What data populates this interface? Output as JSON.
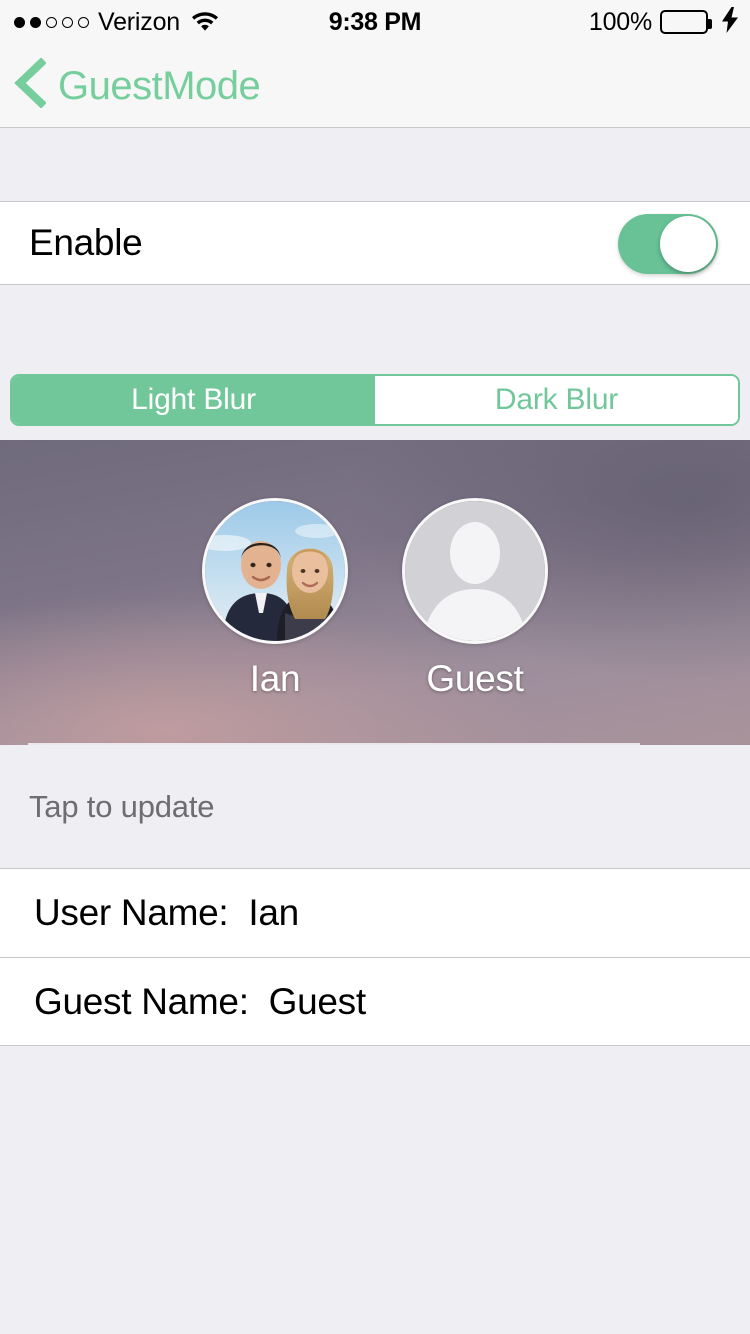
{
  "status_bar": {
    "signal_dots_filled": 2,
    "signal_dots_total": 5,
    "carrier": "Verizon",
    "wifi_icon": "wifi-icon",
    "time": "9:38 PM",
    "battery_percent": "100%",
    "battery_level": 100,
    "charging": true,
    "charging_icon": "lightning-bolt-icon"
  },
  "nav_bar": {
    "back_icon": "chevron-left-icon",
    "back_label": "GuestMode"
  },
  "enable_row": {
    "label": "Enable",
    "toggle_on": true
  },
  "segmented_control": {
    "options": [
      {
        "label": "Light Blur",
        "selected": true
      },
      {
        "label": "Dark Blur",
        "selected": false
      }
    ]
  },
  "preview": {
    "users": [
      {
        "name": "Ian",
        "avatar": "photo-avatar"
      },
      {
        "name": "Guest",
        "avatar": "default-person-avatar"
      }
    ]
  },
  "tap_section": {
    "label": "Tap to update"
  },
  "name_rows": [
    {
      "label": "User Name:",
      "value": "Ian",
      "text": "User Name:  Ian"
    },
    {
      "label": "Guest Name:",
      "value": "Guest",
      "text": "Guest Name:  Guest"
    }
  ],
  "colors": {
    "accent_green": "#72c79a",
    "toggle_green": "#68c296",
    "battery_green": "#4cd964",
    "group_bg": "#eeeef3",
    "hairline": "#c8c7cc",
    "secondary_text": "#6d6d72"
  }
}
